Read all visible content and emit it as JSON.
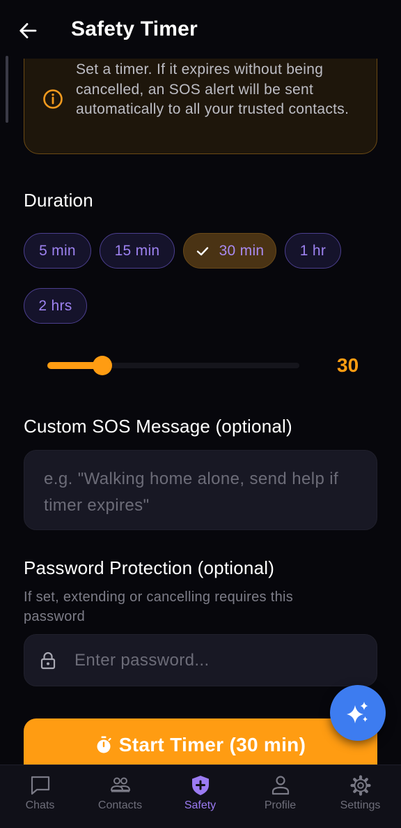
{
  "header": {
    "title": "Safety Timer",
    "back_icon": "arrow-left-icon"
  },
  "info": {
    "icon": "info-circle-icon",
    "text": "Set a timer. If it expires without being cancelled, an SOS alert will be sent automatically to all your trusted contacts."
  },
  "duration": {
    "label": "Duration",
    "options": [
      "5 min",
      "15 min",
      "30 min",
      "1 hr",
      "2 hrs"
    ],
    "selected": "30 min",
    "slider_value": "30"
  },
  "message": {
    "label": "Custom SOS Message (optional)",
    "placeholder": "e.g. \"Walking home alone, send help if timer expires\""
  },
  "password": {
    "label": "Password Protection (optional)",
    "helper": "If set, extending or cancelling requires this password",
    "placeholder": "Enter password..."
  },
  "start_button": {
    "label": "Start Timer (30 min)"
  },
  "fab": {
    "icon": "sparkle-icon"
  },
  "nav": {
    "items": [
      {
        "label": "Chats",
        "icon": "chat-bubble-icon"
      },
      {
        "label": "Contacts",
        "icon": "group-icon"
      },
      {
        "label": "Safety",
        "icon": "shield-plus-icon"
      },
      {
        "label": "Profile",
        "icon": "person-icon"
      },
      {
        "label": "Settings",
        "icon": "gear-icon"
      }
    ],
    "active": "Safety"
  },
  "colors": {
    "accent": "#ff9c12",
    "purple": "#9b7bf2",
    "fab": "#3d7cf0",
    "background": "#07070c"
  }
}
